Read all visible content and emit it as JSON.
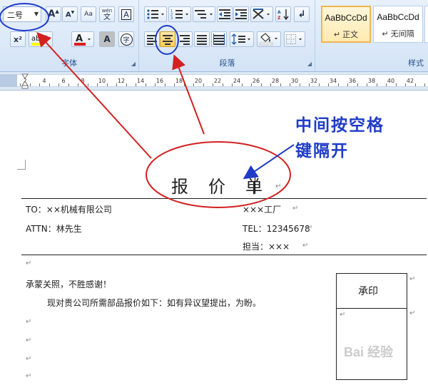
{
  "font_group": {
    "label": "字体",
    "font_size_value": "二号",
    "change_case_label": "Aa",
    "phonetic_label": "wén",
    "phonetic_char": "文",
    "boxed_char": "A",
    "superscript_label": "x²",
    "char_shading_label": "A",
    "enclosed_char": "字"
  },
  "paragraph_group": {
    "label": "段落"
  },
  "styles_group": {
    "label": "样式",
    "cards": [
      {
        "sample": "AaBbCcDd",
        "name": "↵ 正文"
      },
      {
        "sample": "AaBbCcDd",
        "name": "↵ 无间隔"
      }
    ]
  },
  "ruler": {
    "numbers": [
      "2",
      "2",
      "4",
      "6",
      "8",
      "10",
      "12",
      "14",
      "16",
      "18",
      "20",
      "22",
      "24",
      "26",
      "28",
      "30",
      "32",
      "34",
      "36",
      "38",
      "40",
      "42"
    ]
  },
  "document": {
    "title": "报　价　单",
    "to_line": "TO：××机械有限公司",
    "factory": "×××工厂",
    "attn_line": "ATTN：林先生",
    "tel_line": "TEL：12345678",
    "contact_line": "担当：×××",
    "greeting": "承蒙关照，不胜感谢！",
    "body": "现对贵公司所需部品报价如下：如有异议望提出，为盼。",
    "seal_label": "承印",
    "para_mark": "↵"
  },
  "annotation": {
    "line1": "中间按空格",
    "line2": "键隔开"
  },
  "watermark": "Bai 经验",
  "colors": {
    "annotation": "#1f3cc8",
    "arrows": "#d32020",
    "highlight_button": "#ffcd57"
  }
}
